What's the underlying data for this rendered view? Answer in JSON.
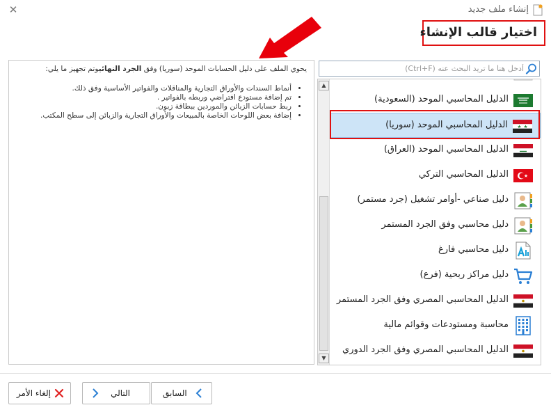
{
  "window": {
    "title": "إنشاء ملف جديد",
    "close_symbol": "✕"
  },
  "heading": "اختيار قالب الإنشاء",
  "search": {
    "placeholder": "أدخل هنا ما تريد البحث عنه (Ctrl+F)",
    "value": ""
  },
  "description": {
    "intro_before": "يحوي الملف على دليل الحسابات الموحد (سوريا) وفق ",
    "intro_bold": "الجرد النهائي",
    "intro_after": "وتم تجهيز ما يلي:",
    "bullets": [
      "أنماط السندات والأوراق التجارية والمناقلات والفواتير الأساسية وفق ذلك.",
      "تم إضافة مستودع افتراضي وربطه بالفواتير .",
      "ربط حسابات الزبائن والموردين ببطاقة زبون.",
      "إضافة بعض اللوحات الخاصة بالمبيعات والأوراق التجارية والزبائن إلى سطح المكتب."
    ]
  },
  "templates": [
    {
      "label": "الدليل المحاسبي الموحد (السعودية)",
      "icon": "flag-saudi-icon"
    },
    {
      "label": "الدليل المحاسبي الموحد (سوريا)",
      "icon": "flag-syria-icon",
      "selected": true
    },
    {
      "label": "الدليل المحاسبي الموحد (العراق)",
      "icon": "flag-iraq-icon"
    },
    {
      "label": "الدليل المحاسبي التركي",
      "icon": "flag-turkey-icon"
    },
    {
      "label": "دليل صناعي -أوامر تشغيل (جرد مستمر)",
      "icon": "contact-card-icon"
    },
    {
      "label": "دليل محاسبي وفق الجرد المستمر",
      "icon": "contact-card-icon"
    },
    {
      "label": "دليل محاسبي فارغ",
      "icon": "blank-document-icon"
    },
    {
      "label": "دليل مراكز ربحية (فرع)",
      "icon": "shopping-cart-icon"
    },
    {
      "label": "الدليل المحاسبي المصري وفق الجرد المستمر",
      "icon": "flag-egypt-icon"
    },
    {
      "label": "محاسبة ومستودعات وقوائم مالية",
      "icon": "building-icon"
    },
    {
      "label": "الدليل المحاسبي المصري وفق الجرد الدوري",
      "icon": "flag-egypt-icon"
    }
  ],
  "buttons": {
    "cancel": "إلغاء الأمر",
    "next": "التالي",
    "prev": "السابق"
  },
  "colors": {
    "highlight_outline": "#e01010",
    "selection_bg": "#cde4f7",
    "accent_blue": "#2a7fd4"
  }
}
